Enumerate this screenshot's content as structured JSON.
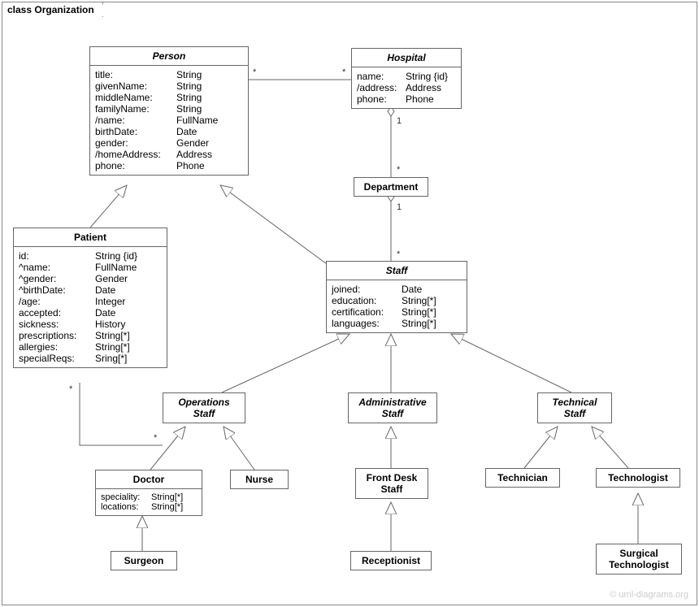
{
  "frame": {
    "label": "class Organization"
  },
  "classes": {
    "person": {
      "title": "Person",
      "attrs": [
        {
          "name": "title:",
          "type": "String"
        },
        {
          "name": "givenName:",
          "type": "String"
        },
        {
          "name": "middleName:",
          "type": "String"
        },
        {
          "name": "familyName:",
          "type": "String"
        },
        {
          "name": "/name:",
          "type": "FullName"
        },
        {
          "name": "birthDate:",
          "type": "Date"
        },
        {
          "name": "gender:",
          "type": "Gender"
        },
        {
          "name": "/homeAddress:",
          "type": "Address"
        },
        {
          "name": "phone:",
          "type": "Phone"
        }
      ]
    },
    "hospital": {
      "title": "Hospital",
      "attrs": [
        {
          "name": "name:",
          "type": "String {id}"
        },
        {
          "name": "/address:",
          "type": "Address"
        },
        {
          "name": "phone:",
          "type": "Phone"
        }
      ]
    },
    "department": {
      "title": "Department"
    },
    "patient": {
      "title": "Patient",
      "attrs": [
        {
          "name": "id:",
          "type": "String {id}"
        },
        {
          "name": "^name:",
          "type": "FullName"
        },
        {
          "name": "^gender:",
          "type": "Gender"
        },
        {
          "name": "^birthDate:",
          "type": "Date"
        },
        {
          "name": "/age:",
          "type": "Integer"
        },
        {
          "name": "accepted:",
          "type": "Date"
        },
        {
          "name": "sickness:",
          "type": "History"
        },
        {
          "name": "prescriptions:",
          "type": "String[*]"
        },
        {
          "name": "allergies:",
          "type": "String[*]"
        },
        {
          "name": "specialReqs:",
          "type": "Sring[*]"
        }
      ]
    },
    "staff": {
      "title": "Staff",
      "attrs": [
        {
          "name": "joined:",
          "type": "Date"
        },
        {
          "name": "education:",
          "type": "String[*]"
        },
        {
          "name": "certification:",
          "type": "String[*]"
        },
        {
          "name": "languages:",
          "type": "String[*]"
        }
      ]
    },
    "opsStaff": {
      "title": "Operations\nStaff"
    },
    "adminStaff": {
      "title": "Administrative\nStaff"
    },
    "techStaff": {
      "title": "Technical\nStaff"
    },
    "doctor": {
      "title": "Doctor",
      "attrs": [
        {
          "name": "speciality:",
          "type": "String[*]"
        },
        {
          "name": "locations:",
          "type": "String[*]"
        }
      ]
    },
    "nurse": {
      "title": "Nurse"
    },
    "frontDesk": {
      "title": "Front Desk\nStaff"
    },
    "technician": {
      "title": "Technician"
    },
    "technologist": {
      "title": "Technologist"
    },
    "surgeon": {
      "title": "Surgeon"
    },
    "receptionist": {
      "title": "Receptionist"
    },
    "surgTech": {
      "title": "Surgical\nTechnologist"
    }
  },
  "mult": {
    "person_hosp_left": "*",
    "person_hosp_right": "*",
    "hosp_dept_top": "1",
    "hosp_dept_bot": "*",
    "dept_staff_top": "1",
    "dept_staff_bot": "*",
    "patient_ops_left": "*",
    "patient_ops_right": "*"
  },
  "watermark": "© uml-diagrams.org"
}
